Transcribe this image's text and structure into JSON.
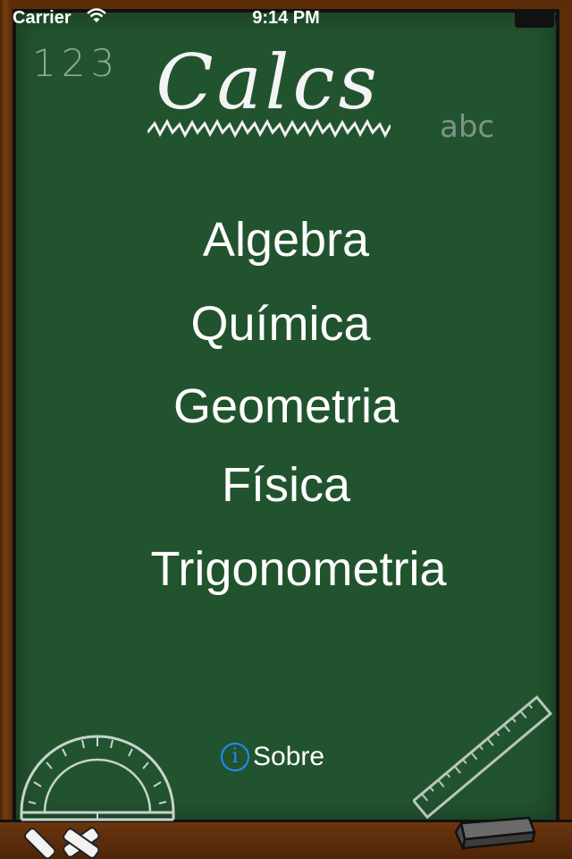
{
  "status_bar": {
    "carrier": "Carrier",
    "time": "9:14 PM"
  },
  "header": {
    "title": "Calcs",
    "chalk_numbers": "123",
    "chalk_letters": "abc"
  },
  "menu": {
    "items": [
      {
        "label": "Algebra"
      },
      {
        "label": "Química"
      },
      {
        "label": "Geometria"
      },
      {
        "label": "Física"
      },
      {
        "label": "Trigonometria"
      }
    ]
  },
  "about": {
    "label": "Sobre",
    "icon": "info-icon",
    "icon_color": "#1e8bff"
  },
  "theme": {
    "board_color": "#22532f",
    "frame_color": "#5a2e0a",
    "chalk_color": "#ffffff"
  }
}
